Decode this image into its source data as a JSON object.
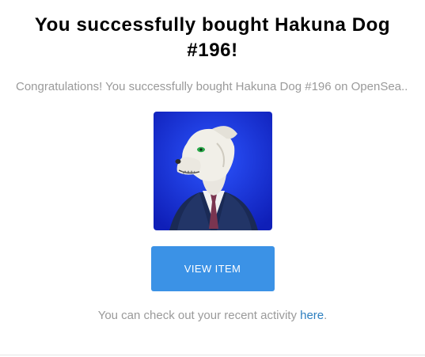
{
  "header": {
    "title": "You successfully bought Hakuna Dog #196!"
  },
  "message": {
    "text": "Congratulations! You successfully bought Hakuna Dog #196 on OpenSea.."
  },
  "nft": {
    "alt": "Hakuna Dog #196",
    "background_color": "#1736e0"
  },
  "actions": {
    "view_item_label": "VIEW ITEM",
    "button_color": "#3b92e6"
  },
  "footer": {
    "prefix": "You can check out your recent activity ",
    "link_text": "here",
    "suffix": "."
  }
}
